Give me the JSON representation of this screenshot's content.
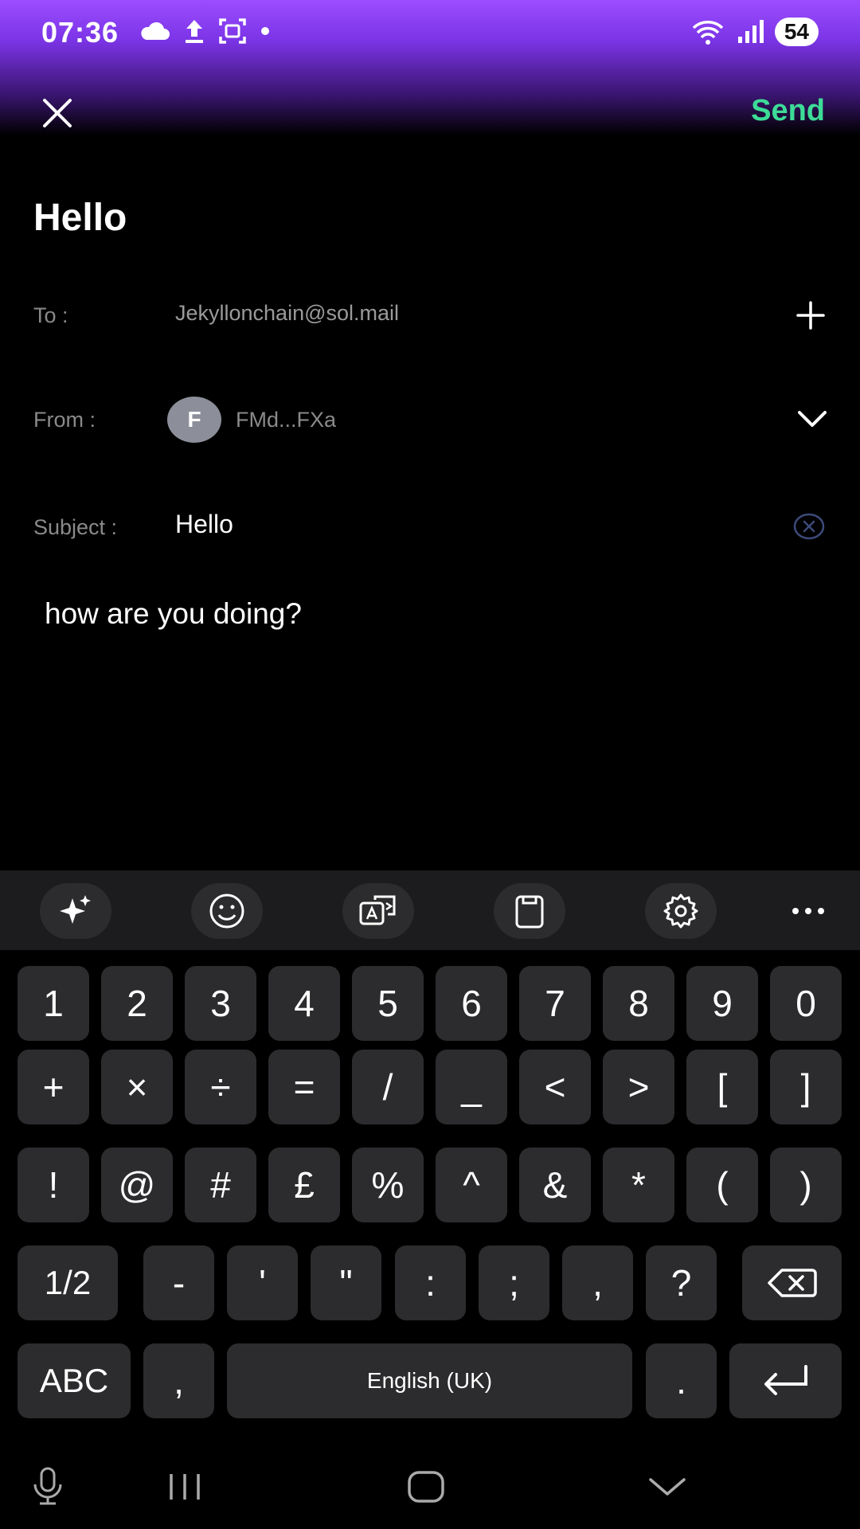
{
  "status_bar": {
    "time": "07:36",
    "left_icons": [
      "cloud-icon",
      "upload-icon",
      "screenshot-icon",
      "dot-icon"
    ],
    "right_icons": [
      "wifi-icon",
      "signal-icon"
    ],
    "battery": "54"
  },
  "header": {
    "close_icon": "close-icon",
    "send_label": "Send"
  },
  "compose": {
    "title": "Hello",
    "to_label": "To :",
    "to_value": "Jekyllonchain@sol.mail",
    "from_label": "From :",
    "from_avatar": "F",
    "from_value": "FMd...FXa",
    "subject_label": "Subject :",
    "subject_value": "Hello",
    "body": "how are you doing?"
  },
  "keyboard": {
    "toolbar": [
      "sparkle-icon",
      "emoji-icon",
      "translate-icon",
      "clipboard-icon",
      "settings-icon",
      "more-icon"
    ],
    "row1": [
      "1",
      "2",
      "3",
      "4",
      "5",
      "6",
      "7",
      "8",
      "9",
      "0"
    ],
    "row2": [
      "+",
      "×",
      "÷",
      "=",
      "/",
      "_",
      "<",
      ">",
      "[",
      "]"
    ],
    "row3": [
      "!",
      "@",
      "#",
      "£",
      "%",
      "^",
      "&",
      "*",
      "(",
      ")"
    ],
    "row4": [
      "1/2",
      "-",
      "'",
      "\"",
      ":",
      ";",
      ",",
      "?"
    ],
    "row5": {
      "abc": "ABC",
      "comma": ",",
      "space": "English (UK)",
      "period": "."
    }
  },
  "nav_bar": [
    "mic-icon",
    "recents-icon",
    "home-icon",
    "hide-keyboard-icon"
  ],
  "colors": {
    "accent": "#3ddc97",
    "header_glow": "#9b4dff",
    "key_bg": "#2c2c2e"
  }
}
